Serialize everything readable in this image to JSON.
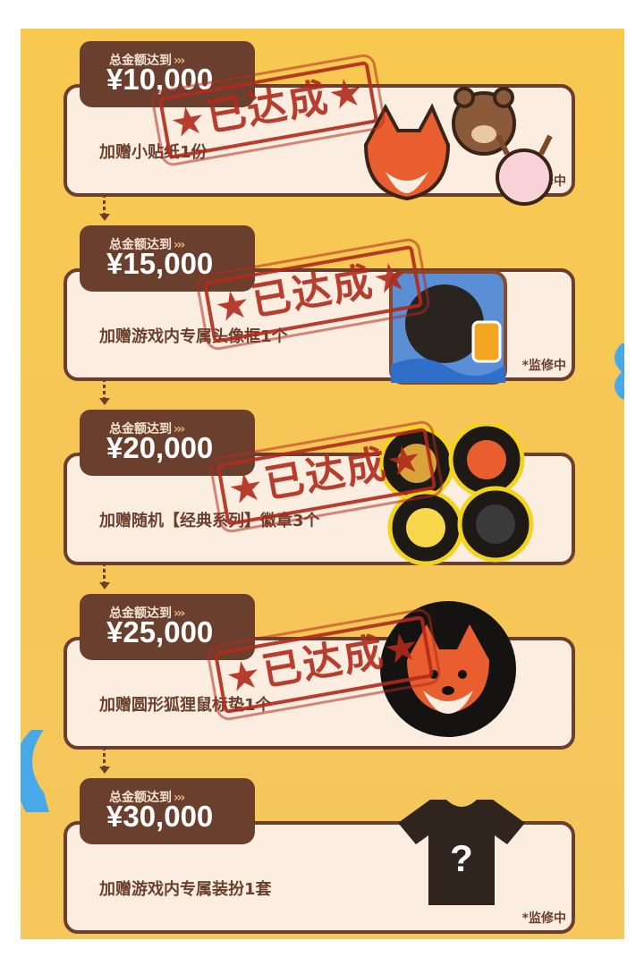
{
  "tiers": [
    {
      "label": "总金额达到",
      "chevrons": "›››",
      "amount": "¥10,000",
      "reward": "加赠小贴纸1份",
      "note": "*监修中",
      "stamp": "★已达成★",
      "icon": "animal-sticker-icon"
    },
    {
      "label": "总金额达到",
      "chevrons": "›››",
      "amount": "¥15,000",
      "reward": "加赠游戏内专属头像框1个",
      "note": "*监修中",
      "stamp": "★已达成★",
      "icon": "avatar-frame-icon"
    },
    {
      "label": "总金额达到",
      "chevrons": "›››",
      "amount": "¥20,000",
      "reward": "加赠随机【经典系列】徽章3个",
      "note": "",
      "stamp": "★已达成★",
      "icon": "badge-icon"
    },
    {
      "label": "总金额达到",
      "chevrons": "›››",
      "amount": "¥25,000",
      "reward": "加赠圆形狐狸鼠标垫1个",
      "note": "",
      "stamp": "★已达成★",
      "icon": "fox-mousepad-icon"
    },
    {
      "label": "总金额达到",
      "chevrons": "›››",
      "amount": "¥30,000",
      "reward": "加赠游戏内专属装扮1套",
      "note": "*监修中",
      "stamp": "",
      "icon": "mystery-tshirt-icon"
    }
  ],
  "mystery_mark": "?"
}
